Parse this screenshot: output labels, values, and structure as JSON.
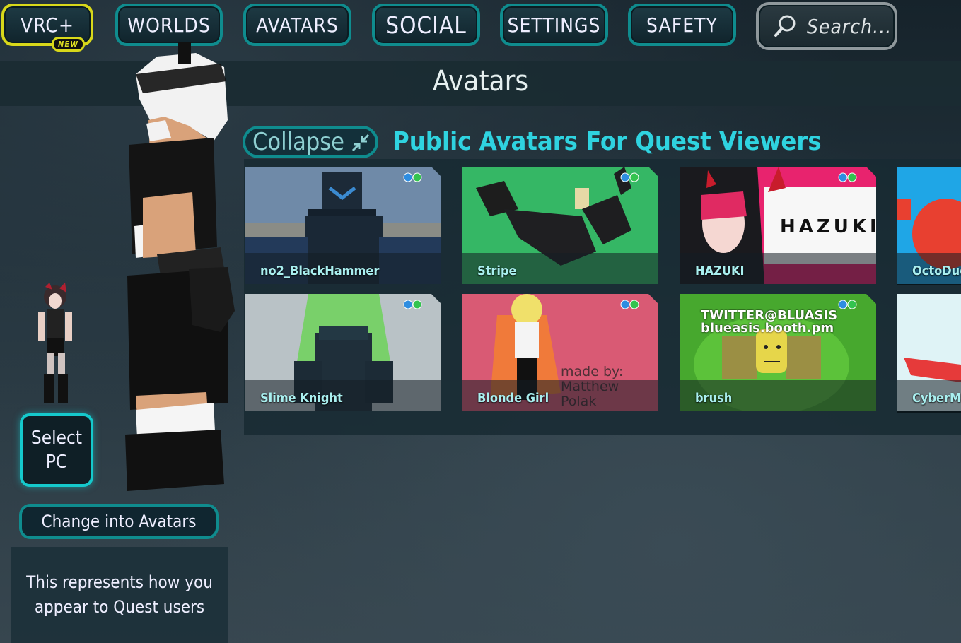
{
  "nav": {
    "vrcplus": "VRC+",
    "new_badge": "NEW",
    "worlds": "WORLDS",
    "avatars": "AVATARS",
    "social": "SOCIAL",
    "settings": "SETTINGS",
    "safety": "SAFETY",
    "search_placeholder": "Search..."
  },
  "header": {
    "title": "Avatars"
  },
  "left": {
    "select_pc_line1": "Select",
    "select_pc_line2": "PC",
    "change_button": "Change into Avatars",
    "info_line1": "This represents how you",
    "info_line2": "appear to Quest users"
  },
  "section": {
    "collapse_label": "Collapse",
    "title": "Public Avatars For Quest Viewers"
  },
  "avatars": [
    {
      "name": "no2_BlackHammer"
    },
    {
      "name": "Stripe"
    },
    {
      "name": "HAZUKI",
      "overlay_text": "HAZUKI"
    },
    {
      "name": "OctoDud"
    },
    {
      "name": "Slime Knight"
    },
    {
      "name": "Blonde Girl",
      "overlay_text": "made by: Matthew Polak"
    },
    {
      "name": "brush",
      "overlay_line1": "TWITTER@BLUASIS",
      "overlay_line2": "blueasis.booth.pm"
    },
    {
      "name": "CyberMa"
    }
  ],
  "colors": {
    "accent_teal": "#0f8c8e",
    "highlight_cyan": "#15c9cc",
    "vrcplus_yellow": "#d8d81a",
    "section_title": "#2fd3e0"
  }
}
